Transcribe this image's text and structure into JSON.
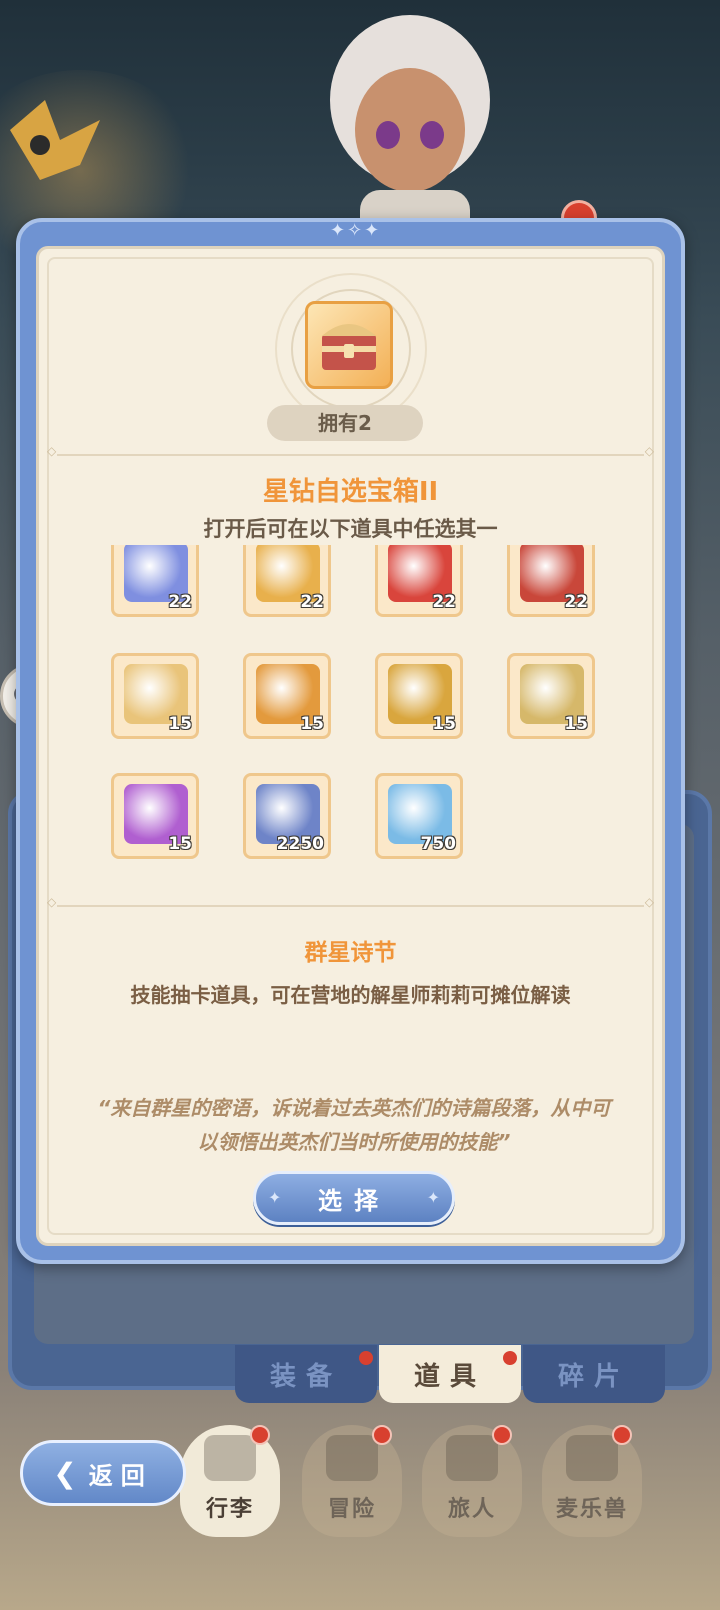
{
  "modal": {
    "owned_label": "拥有2",
    "title": "星钻自选宝箱II",
    "subtitle": "打开后可在以下道具中任选其一",
    "items": [
      {
        "icon": "blue-card-icon",
        "count": "22",
        "color": "#7f8fe0"
      },
      {
        "icon": "gold-card-icon",
        "count": "22",
        "color": "#e8b04c"
      },
      {
        "icon": "red-card-icon",
        "count": "22",
        "color": "#d9453c"
      },
      {
        "icon": "red-seal-icon",
        "count": "22",
        "color": "#c9473a"
      },
      {
        "icon": "lyre-icon",
        "count": "15",
        "color": "#e9c47a"
      },
      {
        "icon": "bell-icon",
        "count": "15",
        "color": "#e39a3d"
      },
      {
        "icon": "gold-bell-icon",
        "count": "15",
        "color": "#d9a63e"
      },
      {
        "icon": "golden-orb-icon",
        "count": "15",
        "color": "#d6b86a"
      },
      {
        "icon": "purple-bell-icon",
        "count": "15",
        "color": "#b05fd0"
      },
      {
        "icon": "crystal-stone-icon",
        "count": "2250",
        "color": "#6e84c8"
      },
      {
        "icon": "crystal-canister-icon",
        "count": "750",
        "color": "#7bbbe6"
      }
    ],
    "selected_item_name": "群星诗节",
    "selected_item_desc": "技能抽卡道具，可在营地的解星师莉莉可摊位解读",
    "quote": "“来自群星的密语，诉说着过去英杰们的诗篇段落，从中可以领悟出英杰们当时所使用的技能”",
    "select_button": "选择"
  },
  "tabs": [
    {
      "label": "装备",
      "active": false
    },
    {
      "label": "道具",
      "active": true
    },
    {
      "label": "碎片",
      "active": false
    }
  ],
  "nav": [
    {
      "label": "行李",
      "active": true
    },
    {
      "label": "冒险",
      "active": false
    },
    {
      "label": "旅人",
      "active": false
    },
    {
      "label": "麦乐兽",
      "active": false
    }
  ],
  "back_button": "返回"
}
